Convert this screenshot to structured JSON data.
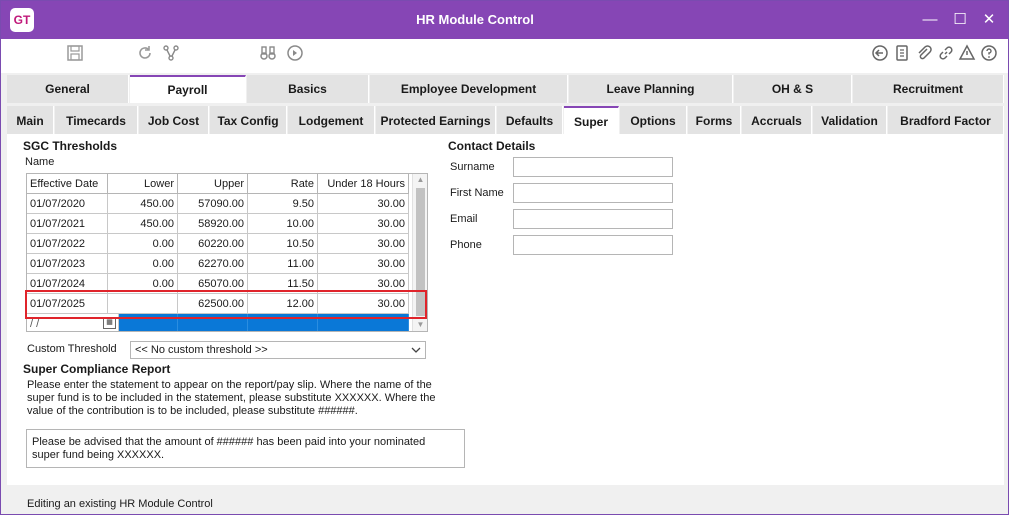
{
  "window": {
    "logo_text": "GT",
    "title": "HR Module Control",
    "controls": {
      "minimize": "—",
      "maximize": "☐",
      "close": "✕"
    }
  },
  "toolbar": {
    "left_icons": [
      "save-icon",
      "refresh-icon",
      "hierarchy-icon",
      "binoculars-icon",
      "record-navigate-icon"
    ],
    "right_icons": [
      "back-arrow-icon",
      "document-icon",
      "attachment-icon",
      "link-icon",
      "alert-icon",
      "help-icon"
    ]
  },
  "top_tabs": [
    {
      "label": "General"
    },
    {
      "label": "Payroll",
      "active": true
    },
    {
      "label": "Basics"
    },
    {
      "label": "Employee Development"
    },
    {
      "label": "Leave Planning"
    },
    {
      "label": "OH & S"
    },
    {
      "label": "Recruitment"
    }
  ],
  "sub_tabs": [
    {
      "label": "Main"
    },
    {
      "label": "Timecards"
    },
    {
      "label": "Job Cost"
    },
    {
      "label": "Tax Config"
    },
    {
      "label": "Lodgement"
    },
    {
      "label": "Protected Earnings"
    },
    {
      "label": "Defaults"
    },
    {
      "label": "Super",
      "active": true
    },
    {
      "label": "Options"
    },
    {
      "label": "Forms"
    },
    {
      "label": "Accruals"
    },
    {
      "label": "Validation"
    },
    {
      "label": "Bradford Factor"
    }
  ],
  "sgc": {
    "title": "SGC Thresholds",
    "name_label": "Name",
    "columns": [
      "Effective Date",
      "Lower",
      "Upper",
      "Rate",
      "Under 18 Hours"
    ],
    "rows": [
      [
        "01/07/2020",
        "450.00",
        "57090.00",
        "9.50",
        "30.00"
      ],
      [
        "01/07/2021",
        "450.00",
        "58920.00",
        "10.00",
        "30.00"
      ],
      [
        "01/07/2022",
        "0.00",
        "60220.00",
        "10.50",
        "30.00"
      ],
      [
        "01/07/2023",
        "0.00",
        "62270.00",
        "11.00",
        "30.00"
      ],
      [
        "01/07/2024",
        "0.00",
        "65070.00",
        "11.50",
        "30.00"
      ],
      [
        "01/07/2025",
        "",
        "62500.00",
        "12.00",
        "30.00"
      ]
    ],
    "new_row_date": "  /   /    "
  },
  "custom_threshold": {
    "label": "Custom Threshold",
    "value": "<< No custom threshold >>"
  },
  "super_report": {
    "title": "Super Compliance Report",
    "instructions": [
      "Please enter the statement to appear on the report/pay slip.  Where the name of the",
      "super fund is to be included in the statement, please substitute XXXXXX.  Where the",
      "value of the contribution is to be included, please substitute ######."
    ],
    "statement": [
      "Please be advised that the amount of ###### has been paid into your nominated",
      "super fund being XXXXXX."
    ]
  },
  "contact": {
    "title": "Contact Details",
    "fields": [
      {
        "label": "Surname",
        "value": ""
      },
      {
        "label": "First Name",
        "value": ""
      },
      {
        "label": "Email",
        "value": ""
      },
      {
        "label": "Phone",
        "value": ""
      }
    ]
  },
  "status": {
    "text": "Editing an existing HR Module Control"
  }
}
